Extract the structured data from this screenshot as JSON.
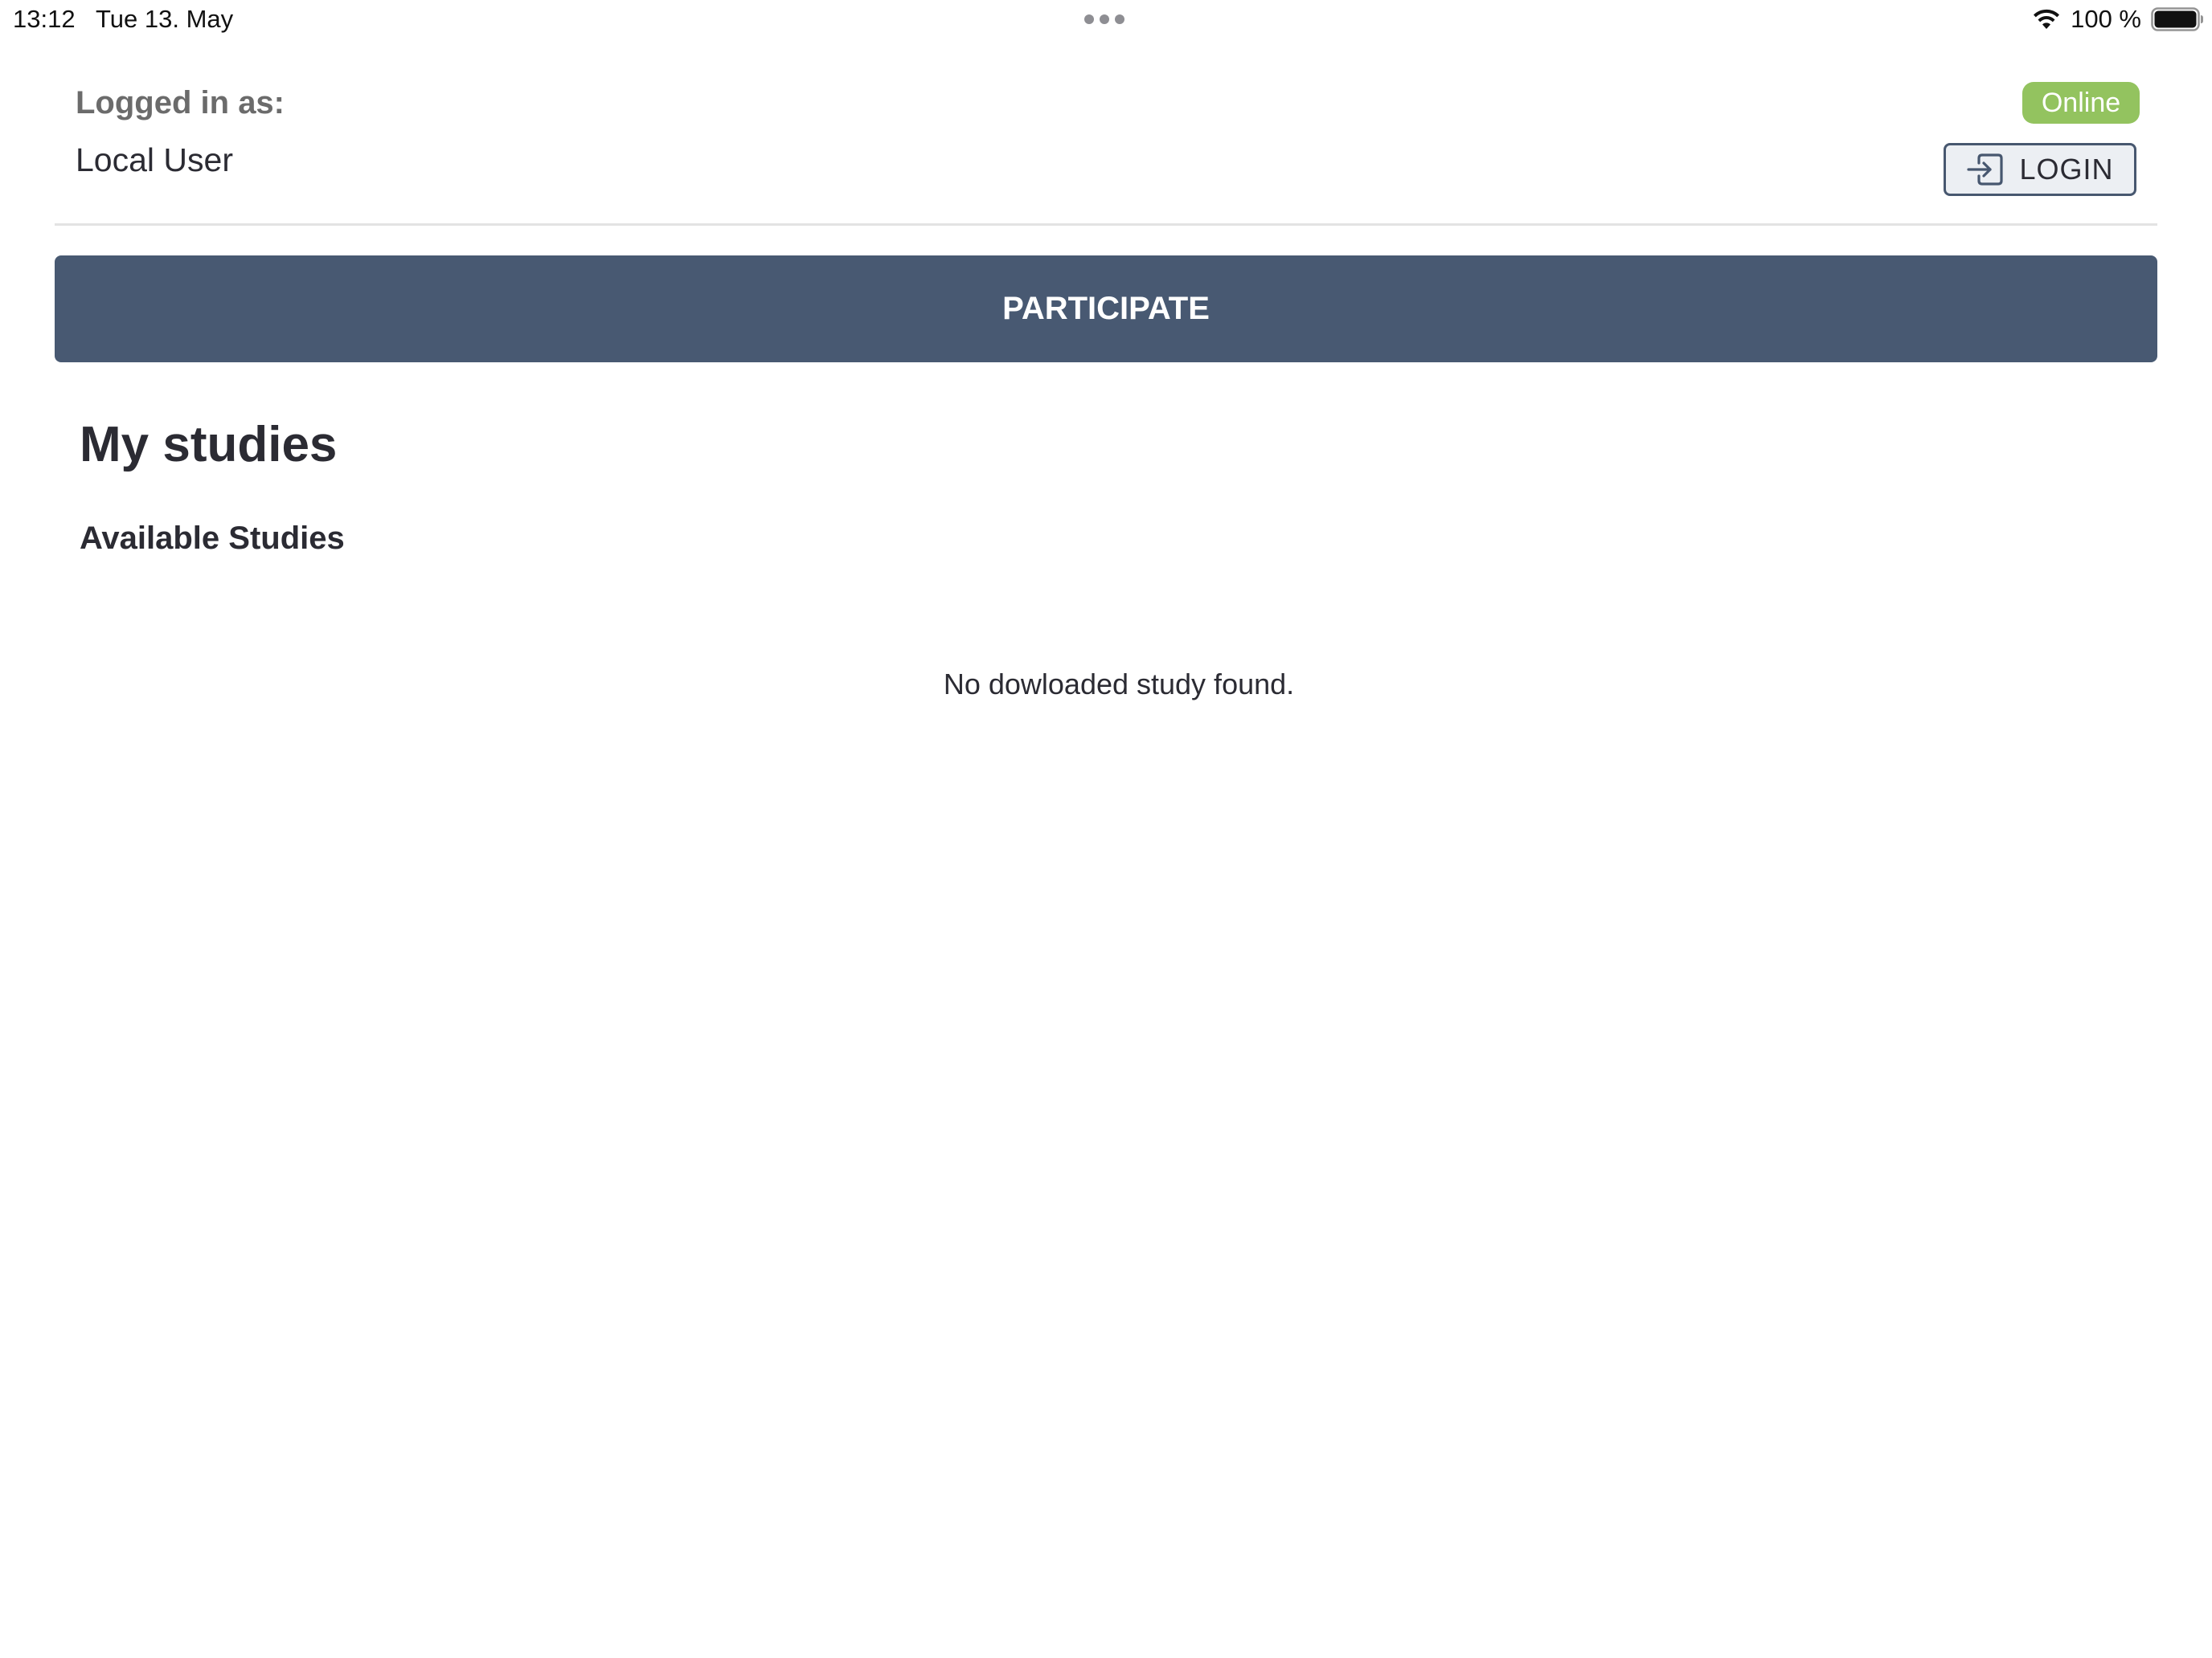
{
  "status_bar": {
    "time": "13:12",
    "date": "Tue 13. May",
    "battery": "100 %",
    "icons": [
      "wifi-icon",
      "battery-icon",
      "multitask-dots-icon"
    ]
  },
  "header": {
    "logged_in_label": "Logged in as:",
    "user_name": "Local User",
    "status_badge": "Online",
    "status_badge_color": "#93c35f",
    "login_button": {
      "label": "LOGIN",
      "icon": "login-icon"
    }
  },
  "participate": {
    "label": "PARTICIPATE",
    "color": "#485972"
  },
  "main": {
    "title": "My studies",
    "section_title": "Available Studies",
    "empty_message": "No dowloaded study found."
  }
}
